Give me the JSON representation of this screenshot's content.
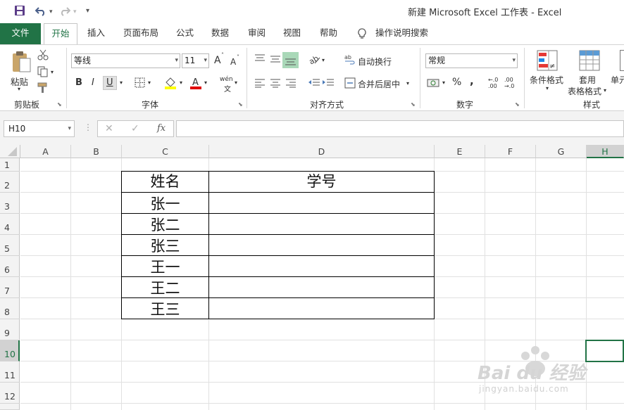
{
  "title_bar": {
    "title": "新建 Microsoft Excel 工作表  -  Excel",
    "qa_icons": [
      "save-icon",
      "undo-icon",
      "redo-icon",
      "customize-icon"
    ]
  },
  "tabs": {
    "file": "文件",
    "items": [
      "开始",
      "插入",
      "页面布局",
      "公式",
      "数据",
      "审阅",
      "视图",
      "帮助"
    ],
    "tell_me": "操作说明搜索",
    "active": "开始"
  },
  "ribbon": {
    "clipboard": {
      "paste": "粘贴",
      "label": "剪贴板"
    },
    "font": {
      "name": "等线",
      "size": "11",
      "bold": "B",
      "italic": "I",
      "underline": "U",
      "increase": "A",
      "decrease": "A",
      "wen": "wén",
      "label": "字体"
    },
    "alignment": {
      "wrap": "自动换行",
      "merge": "合并后居中",
      "label": "对齐方式"
    },
    "number": {
      "format": "常规",
      "percent": "%",
      "comma": ",",
      "inc_dec": ".00",
      "dec_dec": ".0",
      "label": "数字"
    },
    "styles": {
      "conditional": "条件格式",
      "table_1": "套用",
      "table_2": "表格格式",
      "cell": "单元",
      "label": "样式"
    }
  },
  "formula_bar": {
    "name_box": "H10",
    "fx": "fx",
    "value": ""
  },
  "grid": {
    "columns": [
      "A",
      "B",
      "C",
      "D",
      "E",
      "F",
      "G",
      "H"
    ],
    "rows": [
      "1",
      "2",
      "3",
      "4",
      "5",
      "6",
      "7",
      "8",
      "9",
      "10",
      "11",
      "12"
    ],
    "active_column": "H",
    "active_row": "10"
  },
  "table": {
    "header": [
      "姓名",
      "学号"
    ],
    "rows": [
      [
        "张一",
        ""
      ],
      [
        "张二",
        ""
      ],
      [
        "张三",
        ""
      ],
      [
        "王一",
        ""
      ],
      [
        "王二",
        ""
      ],
      [
        "王三",
        ""
      ]
    ]
  },
  "watermark": {
    "brand": "Bai du 经验",
    "url": "jingyan.baidu.com"
  },
  "colors": {
    "accent": "#217346",
    "header_bg": "#f3f3f3",
    "gridline": "#e1e1e1"
  }
}
